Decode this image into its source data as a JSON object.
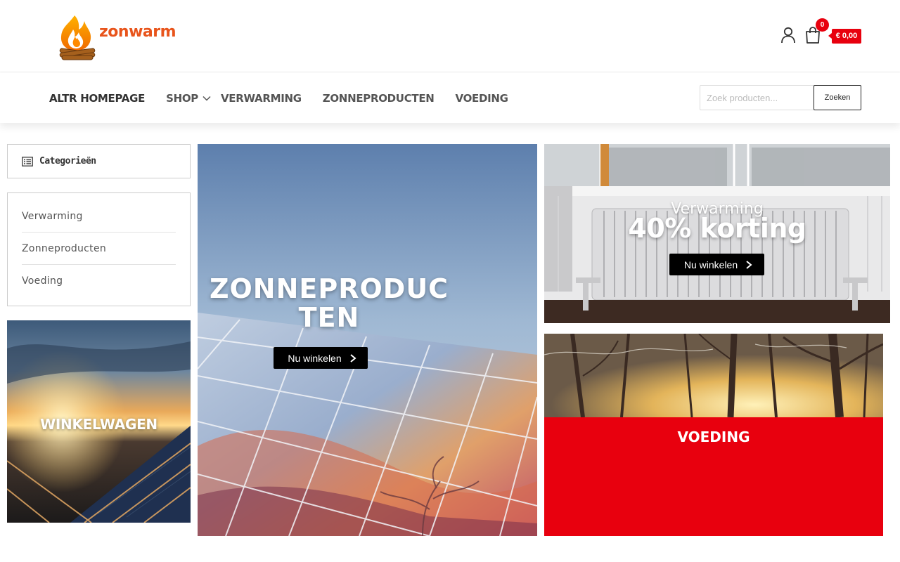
{
  "brand": {
    "name": "zonwarm"
  },
  "header": {
    "cart_count": "0",
    "cart_total": "€ 0,00"
  },
  "nav": {
    "items": [
      "ALTR HOMEPAGE",
      "SHOP",
      "VERWARMING",
      "ZONNEPRODUCTEN",
      "VOEDING"
    ]
  },
  "search": {
    "placeholder": "Zoek producten...",
    "button": "Zoeken"
  },
  "sidebar": {
    "heading": "Categorieën",
    "items": [
      "Verwarming",
      "Zonneproducten",
      "Voeding"
    ]
  },
  "banners": {
    "cart": {
      "title": "WINKELWAGEN"
    },
    "solar": {
      "title": "ZONNEPRODUCTEN",
      "button": "Nu winkelen"
    },
    "heat": {
      "subtitle": "Verwarming",
      "title": "40% korting",
      "button": "Nu winkelen"
    },
    "food": {
      "title": "VOEDING"
    }
  },
  "colors": {
    "accent_red": "#e8000e",
    "brand_orange": "#e8541b"
  },
  "icons": {
    "user": "user-icon",
    "cart": "shopping-bag-icon",
    "categories": "list-icon",
    "chevron": "chevron-right-icon",
    "dropdown": "chevron-down-icon"
  }
}
